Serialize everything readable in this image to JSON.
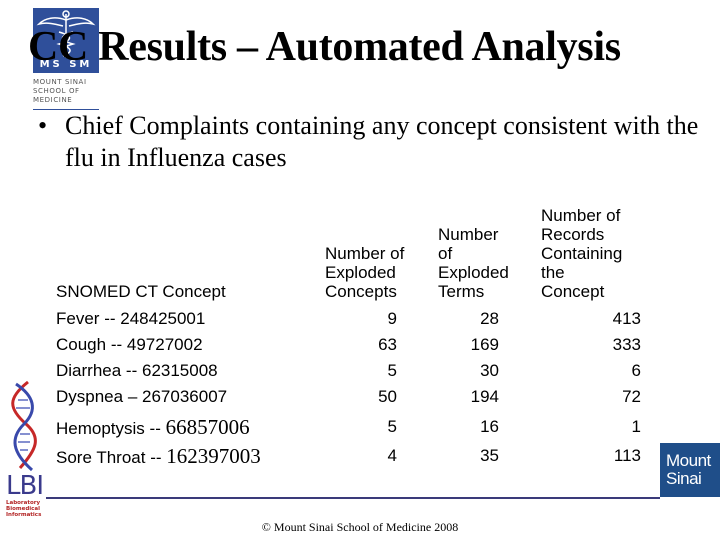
{
  "logos": {
    "mssm": {
      "initials": "MS SM",
      "school_lines": [
        "MOUNT SINAI",
        "SCHOOL OF",
        "MEDICINE"
      ],
      "color": "#2f4f9a"
    },
    "lbi": {
      "letters": "LBI",
      "sub_lines": [
        "Laboratory",
        "Biomedical",
        "Informatics"
      ]
    },
    "mount_sinai": {
      "lines": [
        "Mount",
        "Sinai"
      ],
      "color": "#1f4e89"
    }
  },
  "slide": {
    "title": "CC Results – Automated Analysis",
    "bullet_symbol": "•",
    "bullet_text": "Chief Complaints containing any concept consistent with the flu  in Influenza cases"
  },
  "table": {
    "headers": {
      "concept": "SNOMED CT Concept",
      "exploded_concepts": "Number of\nExploded\nConcepts",
      "exploded_terms": "Number\nof\nExploded\nTerms",
      "records": "Number of\nRecords\nContaining\nthe\nConcept"
    },
    "rows": [
      {
        "name": "Fever",
        "sep": " -- ",
        "code": "248425001",
        "concepts": "9",
        "terms": "28",
        "records": "413"
      },
      {
        "name": "Cough",
        "sep": " -- ",
        "code": "49727002",
        "concepts": "63",
        "terms": "169",
        "records": "333"
      },
      {
        "name": "Diarrhea",
        "sep": " -- ",
        "code": "62315008",
        "concepts": "5",
        "terms": "30",
        "records": "6"
      },
      {
        "name": "Dyspnea",
        "sep": " – ",
        "code": "267036007",
        "concepts": "50",
        "terms": "194",
        "records": "72"
      },
      {
        "name": "Hemoptysis",
        "sep": " -- ",
        "code": "66857006",
        "concepts": "5",
        "terms": "16",
        "records": "1"
      },
      {
        "name": "Sore Throat",
        "sep": " -- ",
        "code": "162397003",
        "concepts": "4",
        "terms": "35",
        "records": "113"
      }
    ]
  },
  "footer": {
    "copyright": "© Mount Sinai School of Medicine 2008"
  }
}
